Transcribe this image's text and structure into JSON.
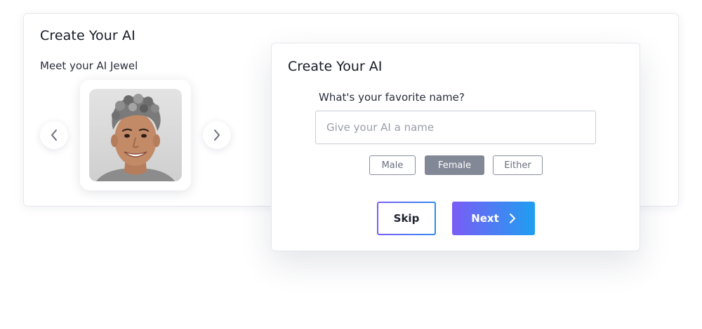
{
  "background_card": {
    "title": "Create Your AI",
    "subtitle": "Meet your AI Jewel",
    "avatar": {
      "description": "portrait of smiling person with curly grey hair",
      "prev_icon": "chevron-left-icon",
      "next_icon": "chevron-right-icon"
    }
  },
  "modal": {
    "title": "Create Your AI",
    "question": "What's your favorite name?",
    "name_input": {
      "value": "",
      "placeholder": "Give your AI a name"
    },
    "gender_options": [
      {
        "label": "Male",
        "selected": false
      },
      {
        "label": "Female",
        "selected": true
      },
      {
        "label": "Either",
        "selected": false
      }
    ],
    "skip_label": "Skip",
    "next_label": "Next",
    "next_icon": "chevron-right-icon"
  },
  "colors": {
    "accent_gradient_start": "#7a5cf6",
    "accent_gradient_end": "#1f9ef0",
    "selected_chip": "#828896"
  }
}
